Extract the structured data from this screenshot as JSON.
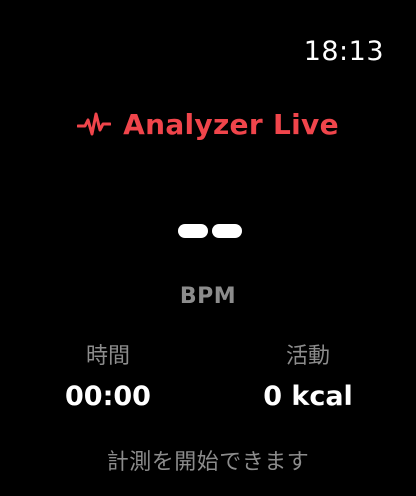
{
  "status_bar": {
    "time": "18:13"
  },
  "header": {
    "icon": "heart-pulse-icon",
    "title": "Analyzer Live",
    "accent_color": "#f0454b"
  },
  "heart_rate": {
    "value_placeholder": "--",
    "unit": "BPM"
  },
  "metrics": {
    "time": {
      "label": "時間",
      "value": "00:00"
    },
    "activity": {
      "label": "活動",
      "value": "0 kcal"
    }
  },
  "status": {
    "message": "計測を開始できます"
  }
}
